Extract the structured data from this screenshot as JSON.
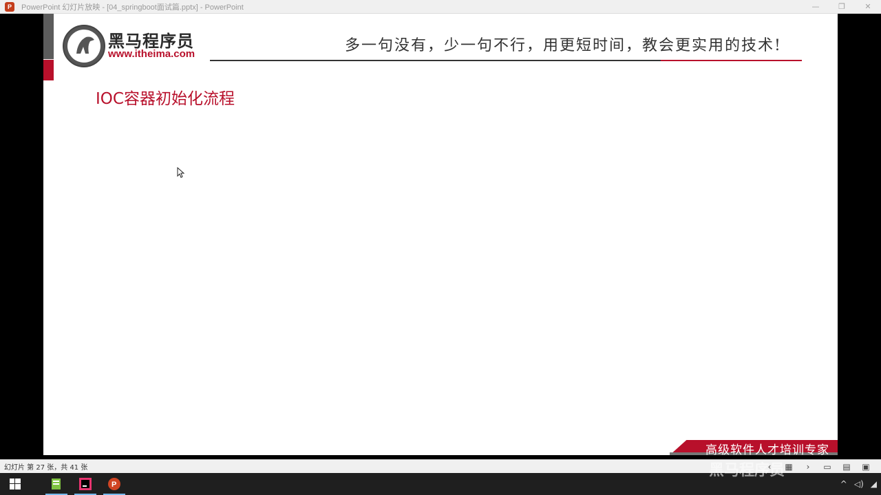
{
  "window": {
    "title": "PowerPoint 幻灯片放映 - [04_springboot面试篇.pptx] - PowerPoint",
    "app_icon_letter": "P",
    "controls": [
      "—",
      "❐",
      "✕"
    ]
  },
  "slide": {
    "logo_name": "黑马程序员",
    "logo_url": "www.itheima.com",
    "slogan": "多一句没有，少一句不行，用更短时间，教会更实用的技术!",
    "title": "IOC容器初始化流程",
    "footer_text": "高级软件人才培训专家"
  },
  "status": {
    "slide_info": "幻灯片 第 27 张，共 41 张",
    "nav": [
      "‹",
      "▦",
      "›",
      "▭",
      "▤",
      "▣"
    ]
  },
  "watermark": "黑马程序员",
  "colors": {
    "brand_red": "#b8102b",
    "slide_bg": "#ffffff",
    "taskbar": "#1f1f1f"
  }
}
